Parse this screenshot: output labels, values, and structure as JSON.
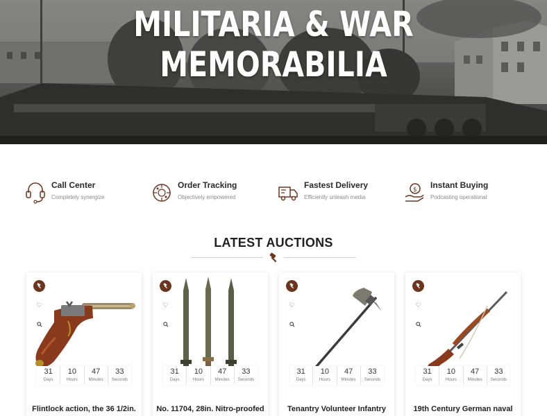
{
  "hero": {
    "title_line1": "MILITARIA & WAR",
    "title_line2": "MEMORABILIA"
  },
  "features": [
    {
      "icon": "headset-icon",
      "title": "Call Center",
      "subtitle": "Completely synergize"
    },
    {
      "icon": "order-tracking-icon",
      "title": "Order Tracking",
      "subtitle": "Objectively empowered"
    },
    {
      "icon": "delivery-truck-icon",
      "title": "Fastest Delivery",
      "subtitle": "Efficiently unleash media"
    },
    {
      "icon": "instant-buying-icon",
      "title": "Instant Buying",
      "subtitle": "Podcasting operational"
    }
  ],
  "section": {
    "title": "LATEST AUCTIONS"
  },
  "colors": {
    "accent": "#6b3520",
    "text": "#222222",
    "muted": "#8a8a8a"
  },
  "countdown_labels": [
    "Days",
    "Hours",
    "Minutes",
    "Seconds"
  ],
  "auctions": [
    {
      "image": "flintlock-pistol",
      "days": "31",
      "hours": "10",
      "minutes": "47",
      "seconds": "33",
      "title": "Flintlock action, the 36 1/2in."
    },
    {
      "image": "bayonets",
      "days": "31",
      "hours": "10",
      "minutes": "47",
      "seconds": "33",
      "title": "No. 11704, 28in. Nitro-proofed"
    },
    {
      "image": "battle-axe",
      "days": "31",
      "hours": "10",
      "minutes": "47",
      "seconds": "33",
      "title": "Tenantry Volunteer Infantry"
    },
    {
      "image": "rifle",
      "days": "31",
      "hours": "10",
      "minutes": "47",
      "seconds": "33",
      "title": "19th Century German naval"
    }
  ]
}
